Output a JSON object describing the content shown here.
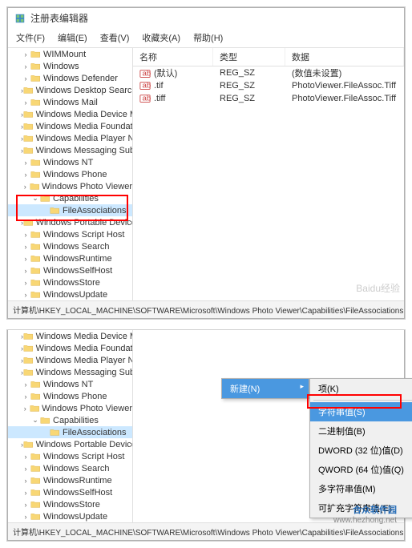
{
  "window": {
    "title": "注册表编辑器"
  },
  "menu": {
    "file": "文件(F)",
    "edit": "编辑(E)",
    "view": "查看(V)",
    "favorites": "收藏夹(A)",
    "help": "帮助(H)"
  },
  "tree1": [
    {
      "label": "WIMMount",
      "indent": 1
    },
    {
      "label": "Windows",
      "indent": 1
    },
    {
      "label": "Windows Defender",
      "indent": 1
    },
    {
      "label": "Windows Desktop Search",
      "indent": 1
    },
    {
      "label": "Windows Mail",
      "indent": 1
    },
    {
      "label": "Windows Media Device Man",
      "indent": 1
    },
    {
      "label": "Windows Media Foundation",
      "indent": 1
    },
    {
      "label": "Windows Media Player NSS",
      "indent": 1
    },
    {
      "label": "Windows Messaging Subsyst",
      "indent": 1
    },
    {
      "label": "Windows NT",
      "indent": 1
    },
    {
      "label": "Windows Phone",
      "indent": 1
    },
    {
      "label": "Windows Photo Viewer",
      "indent": 1
    },
    {
      "label": "Capabilities",
      "indent": 2,
      "toggle": "v"
    },
    {
      "label": "FileAssociations",
      "indent": 3,
      "selected": true
    },
    {
      "label": "Windows Portable Devices",
      "indent": 1
    },
    {
      "label": "Windows Script Host",
      "indent": 1
    },
    {
      "label": "Windows Search",
      "indent": 1
    },
    {
      "label": "WindowsRuntime",
      "indent": 1
    },
    {
      "label": "WindowsSelfHost",
      "indent": 1
    },
    {
      "label": "WindowsStore",
      "indent": 1
    },
    {
      "label": "WindowsUpdate",
      "indent": 1
    }
  ],
  "list_headers": {
    "name": "名称",
    "type": "类型",
    "data": "数据"
  },
  "list_rows": [
    {
      "name": "(默认)",
      "type": "REG_SZ",
      "data": "(数值未设置)"
    },
    {
      "name": ".tif",
      "type": "REG_SZ",
      "data": "PhotoViewer.FileAssoc.Tiff"
    },
    {
      "name": ".tiff",
      "type": "REG_SZ",
      "data": "PhotoViewer.FileAssoc.Tiff"
    }
  ],
  "statusbar1": "计算机\\HKEY_LOCAL_MACHINE\\SOFTWARE\\Microsoft\\Windows Photo Viewer\\Capabilities\\FileAssociations",
  "tree2": [
    {
      "label": "Windows Media Device Man",
      "indent": 1
    },
    {
      "label": "Windows Media Foundation",
      "indent": 1
    },
    {
      "label": "Windows Media Player NSS",
      "indent": 1
    },
    {
      "label": "Windows Messaging Subsyst",
      "indent": 1
    },
    {
      "label": "Windows NT",
      "indent": 1
    },
    {
      "label": "Windows Phone",
      "indent": 1
    },
    {
      "label": "Windows Photo Viewer",
      "indent": 1
    },
    {
      "label": "Capabilities",
      "indent": 2,
      "toggle": "v"
    },
    {
      "label": "FileAssociations",
      "indent": 3,
      "selected": true
    },
    {
      "label": "Windows Portable Devices",
      "indent": 1
    },
    {
      "label": "Windows Script Host",
      "indent": 1
    },
    {
      "label": "Windows Search",
      "indent": 1
    },
    {
      "label": "WindowsRuntime",
      "indent": 1
    },
    {
      "label": "WindowsSelfHost",
      "indent": 1
    },
    {
      "label": "WindowsStore",
      "indent": 1
    },
    {
      "label": "WindowsUpdate",
      "indent": 1
    }
  ],
  "ctx_new": "新建(N)",
  "submenu": [
    {
      "label": "项(K)"
    },
    {
      "label": "字符串值(S)",
      "hl": true
    },
    {
      "label": "二进制值(B)"
    },
    {
      "label": "DWORD (32 位)值(D)"
    },
    {
      "label": "QWORD (64 位)值(Q)"
    },
    {
      "label": "多字符串值(M)"
    },
    {
      "label": "可扩充字符串值(E)"
    }
  ],
  "statusbar2": "计算机\\HKEY_LOCAL_MACHINE\\SOFTWARE\\Microsoft\\Windows Photo Viewer\\Capabilities\\FileAssociations",
  "watermark": "Baidu经验",
  "logo": {
    "main": "合众软件园",
    "sub": "www.hezhong.net"
  }
}
